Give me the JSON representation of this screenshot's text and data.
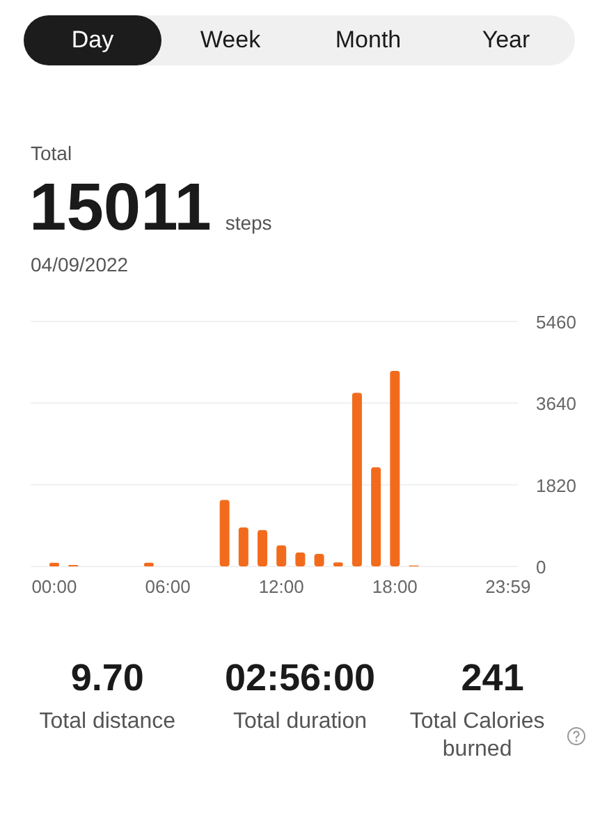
{
  "tabs": [
    {
      "label": "Day",
      "selected": true
    },
    {
      "label": "Week",
      "selected": false
    },
    {
      "label": "Month",
      "selected": false
    },
    {
      "label": "Year",
      "selected": false
    }
  ],
  "summary": {
    "label": "Total",
    "value": "15011",
    "unit": "steps",
    "date": "04/09/2022"
  },
  "chart": {
    "chart_data": {
      "type": "bar",
      "x": [
        0,
        1,
        5,
        9,
        10,
        11,
        12,
        13,
        14,
        15,
        16,
        17,
        18,
        19
      ],
      "series": [
        {
          "color": "#f26b1d",
          "values": [
            80,
            30,
            80,
            1480,
            870,
            810,
            470,
            310,
            280,
            90,
            3870,
            2210,
            4360,
            20
          ]
        }
      ],
      "xlim": [
        -1.25,
        24.5
      ],
      "ylim": [
        0,
        5460
      ],
      "yticks": [
        0,
        1820,
        3640,
        5460
      ],
      "xticks": [
        {
          "value": 0,
          "label": "00:00"
        },
        {
          "value": 6,
          "label": "06:00"
        },
        {
          "value": 12,
          "label": "12:00"
        },
        {
          "value": 18,
          "label": "18:00"
        },
        {
          "value": 23.98,
          "label": "23:59"
        }
      ]
    }
  },
  "stats": [
    {
      "value": "9.70",
      "label": "Total distance",
      "help": false
    },
    {
      "value": "02:56:00",
      "label": "Total duration",
      "help": false
    },
    {
      "value": "241",
      "label": "Total Calories burned",
      "help": true
    }
  ]
}
